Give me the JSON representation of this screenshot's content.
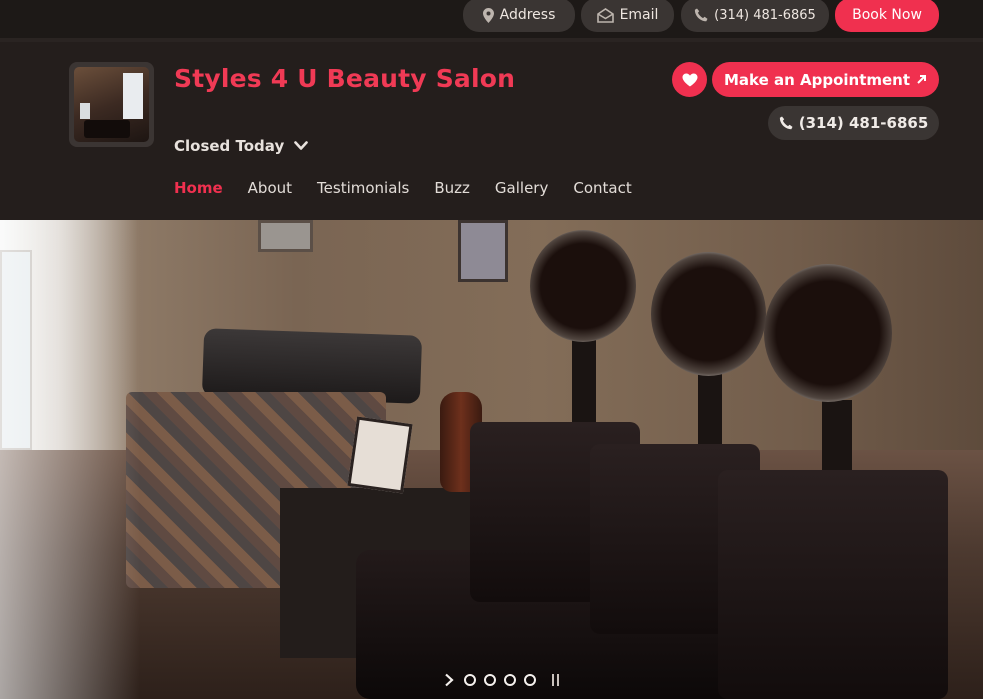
{
  "topbar": {
    "address_label": "Address",
    "email_label": "Email",
    "phone_label": "(314) 481-6865",
    "book_label": "Book Now"
  },
  "header": {
    "salon_name": "Styles 4 U Beauty Salon",
    "hours_status": "Closed Today",
    "appointment_label": "Make an Appointment",
    "phone_label": "(314) 481-6865"
  },
  "nav": {
    "items": [
      {
        "label": "Home",
        "active": true
      },
      {
        "label": "About"
      },
      {
        "label": "Testimonials"
      },
      {
        "label": "Buzz"
      },
      {
        "label": "Gallery"
      },
      {
        "label": "Contact"
      }
    ]
  },
  "slider": {
    "slide_count": 4,
    "current": 1
  },
  "colors": {
    "accent": "#f0304f",
    "header_bg": "#241e1c",
    "pill_bg": "#3a3533"
  },
  "icons": {
    "address": "map-pin-icon",
    "email": "envelope-icon",
    "phone": "phone-icon",
    "favorite": "heart-icon",
    "external": "arrow-up-right-icon",
    "hours": "chevron-down-icon",
    "slider_next": "chevron-right-icon",
    "slider_pause": "pause-icon"
  }
}
